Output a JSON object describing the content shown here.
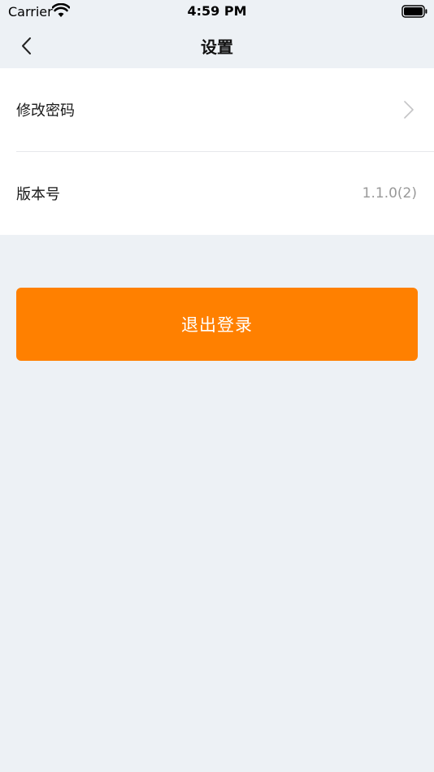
{
  "status_bar": {
    "carrier": "Carrier",
    "time": "4:59 PM",
    "wifi_icon": "wifi-icon",
    "battery_icon": "battery-icon"
  },
  "nav": {
    "title": "设置",
    "back_icon": "chevron-left-icon"
  },
  "settings": {
    "items": [
      {
        "label": "修改密码",
        "icon": "chevron-right-icon"
      },
      {
        "label": "版本号",
        "value": "1.1.0(2)"
      }
    ]
  },
  "logout": {
    "label": "退出登录"
  },
  "colors": {
    "accent": "#ff8000",
    "background": "#edf1f5",
    "list_background": "#ffffff",
    "secondary_text": "#999999",
    "divider": "#e6e8eb"
  }
}
